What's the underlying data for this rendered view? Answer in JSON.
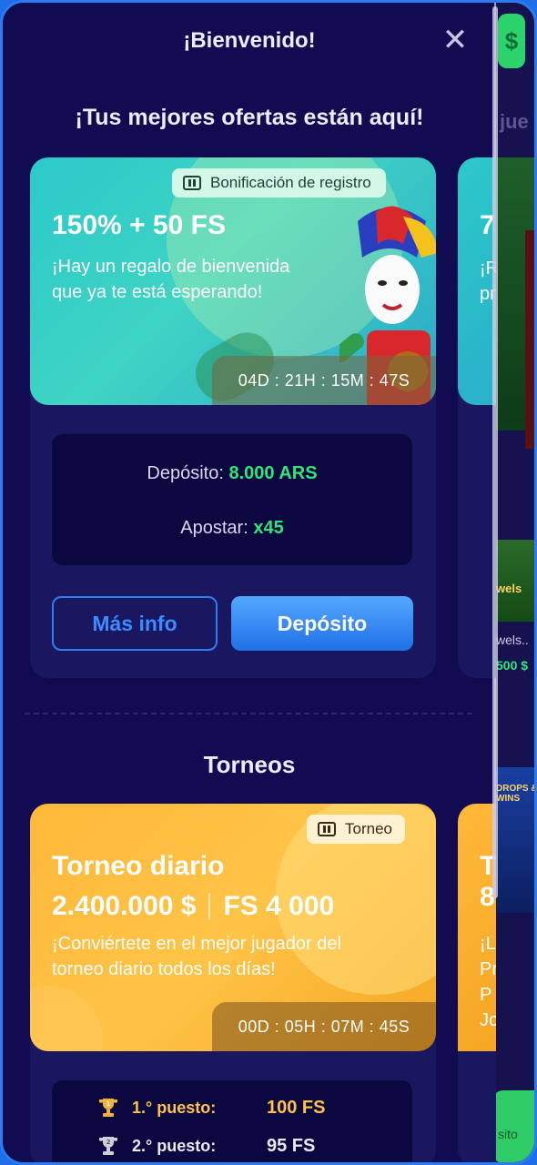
{
  "modal": {
    "title": "¡Bienvenido!",
    "close_label": "✕",
    "subtitle": "¡Tus mejores ofertas están aquí!"
  },
  "background": {
    "dollar_label": "$",
    "peek_heading": "jue",
    "peek_game_1": "wels",
    "peek_game_1_name": "wels..",
    "peek_game_1_prize": "500 $",
    "peek_game_2": "DROPS & WINS",
    "peek_button": "sito"
  },
  "offers": [
    {
      "badge": "Bonificación de registro",
      "title": "150% + 50 FS",
      "description": "¡Hay un regalo de bienvenida que ya te está esperando!",
      "timer": "04D : 21H : 15M : 47S",
      "deposit_label": "Depósito:",
      "deposit_value": "8.000 ARS",
      "wager_label": "Apostar:",
      "wager_value": "x45",
      "more_info_button": "Más info",
      "deposit_button": "Depósito"
    },
    {
      "title": "7",
      "description": "¡R pr"
    }
  ],
  "tournaments_section": {
    "title": "Torneos"
  },
  "tournaments": [
    {
      "badge": "Torneo",
      "title": "Torneo diario",
      "prize_money": "2.400.000 $",
      "prize_fs": "FS 4 000",
      "description": "¡Conviértete en el mejor jugador del torneo diario todos los días!",
      "timer": "00D : 05H : 07M : 45S",
      "places": [
        {
          "label": "1.° puesto:",
          "prize": "100 FS",
          "color": "#ffc34a"
        },
        {
          "label": "2.° puesto:",
          "prize": "95 FS",
          "color": "#e8e8f0"
        }
      ]
    },
    {
      "title": "T 8",
      "description": "¡L Pragr P Joke"
    }
  ],
  "colors": {
    "accent": "#2f7ff2",
    "green": "#2ee57a",
    "gold": "#ffc34a"
  }
}
